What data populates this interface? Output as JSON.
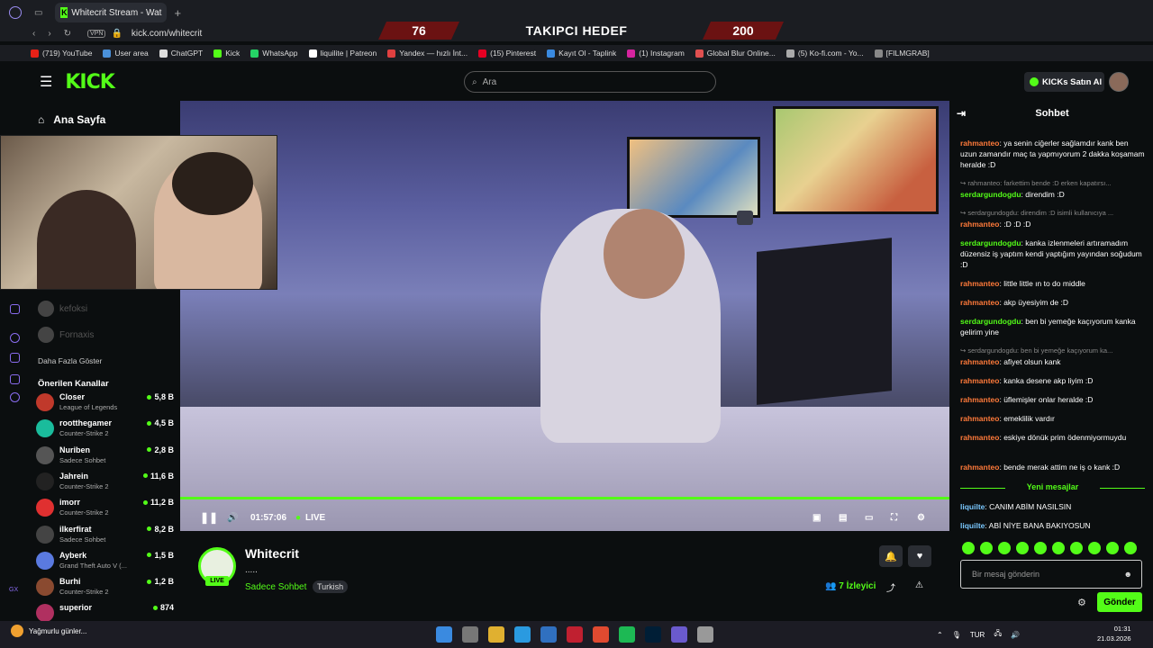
{
  "browser": {
    "tab_title": "Whitecrit Stream - Wat",
    "url": "kick.com/whitecrit",
    "vpn_label": "VPN",
    "bookmarks": [
      {
        "label": "(719) YouTube",
        "color": "#e62117"
      },
      {
        "label": "User area",
        "color": "#4a90d9"
      },
      {
        "label": "ChatGPT",
        "color": "#dddddd"
      },
      {
        "label": "Kick",
        "color": "#53fc18"
      },
      {
        "label": "WhatsApp",
        "color": "#25d366"
      },
      {
        "label": "liquilite | Patreon",
        "color": "#ffffff"
      },
      {
        "label": "Yandex — hızlı İnt...",
        "color": "#e04040"
      },
      {
        "label": "(15) Pinterest",
        "color": "#e60023"
      },
      {
        "label": "Kayıt Ol - Taplink",
        "color": "#3a8ae0"
      },
      {
        "label": "(1) Instagram",
        "color": "#d6249f"
      },
      {
        "label": "Global Blur Online...",
        "color": "#e05050"
      },
      {
        "label": "(5) Ko-fi.com - Yo...",
        "color": "#aaaaaa"
      },
      {
        "label": "[FILMGRAB]",
        "color": "#888888"
      }
    ]
  },
  "overlay": {
    "left": "76",
    "middle": "TAKIPCI HEDEF",
    "right": "200"
  },
  "header": {
    "logo": "KICK",
    "search_placeholder": "Ara",
    "buy_kicks": "KICKs Satın Al"
  },
  "sidebar": {
    "home": "Ana Sayfa",
    "ghost_channels": [
      "kefoksi",
      "Fornaxis"
    ],
    "show_more": "Daha Fazla Göster",
    "suggested_title": "Önerilen Kanallar",
    "channels": [
      {
        "name": "Closer",
        "game": "League of Legends",
        "viewers": "5,8 B",
        "color": "#c0392b"
      },
      {
        "name": "rootthegamer",
        "game": "Counter-Strike 2",
        "viewers": "4,5 B",
        "color": "#1abc9c"
      },
      {
        "name": "Nuriben",
        "game": "Sadece Sohbet",
        "viewers": "2,8 B",
        "color": "#555555"
      },
      {
        "name": "Jahrein",
        "game": "Counter-Strike 2",
        "viewers": "11,6 B",
        "color": "#222222"
      },
      {
        "name": "imorr",
        "game": "Counter-Strike 2",
        "viewers": "11,2 B",
        "color": "#e03030"
      },
      {
        "name": "ilkerfirat",
        "game": "Sadece Sohbet",
        "viewers": "8,2 B",
        "color": "#444444"
      },
      {
        "name": "Ayberk",
        "game": "Grand Theft Auto V (...",
        "viewers": "1,5 B",
        "color": "#5a7ae0"
      },
      {
        "name": "Burhi",
        "game": "Counter-Strike 2",
        "viewers": "1,2 B",
        "color": "#8a4a30"
      },
      {
        "name": "superior",
        "game": "",
        "viewers": "874",
        "color": "#b03060"
      }
    ]
  },
  "player": {
    "time": "01:57:06",
    "live": "LIVE"
  },
  "stream": {
    "name": "Whitecrit",
    "title": ".....",
    "category": "Sadece Sohbet",
    "language": "Turkish",
    "viewers": "7",
    "viewers_label": "İzleyici",
    "live_badge": "LIVE"
  },
  "chat": {
    "title": "Sohbet",
    "messages": [
      {
        "type": "msg",
        "user": "rahmanteo",
        "color": "orange",
        "text": "ya senin ciğerler sağlamdır kank ben uzun zamandır maç ta yapmıyorum 2 dakka koşamam heralde :D"
      },
      {
        "type": "reply",
        "text": "↪ rahmanteo: farkettim bende :D erken kapatırsı..."
      },
      {
        "type": "msg",
        "user": "serdargundogdu",
        "color": "green",
        "text": "direndim :D"
      },
      {
        "type": "reply",
        "text": "↪ serdargundogdu: direndim :D isimli kullanıcıya ..."
      },
      {
        "type": "msg",
        "user": "rahmanteo",
        "color": "orange",
        "text": ":D :D :D"
      },
      {
        "type": "msg",
        "user": "serdargundogdu",
        "color": "green",
        "text": "kanka izlenmeleri artıramadım düzensiz iş yaptım kendi yaptığım yayından soğudum :D"
      },
      {
        "type": "msg",
        "user": "rahmanteo",
        "color": "orange",
        "text": "little little ın to do middle"
      },
      {
        "type": "msg",
        "user": "rahmanteo",
        "color": "orange",
        "text": "akp üyesiyim de :D"
      },
      {
        "type": "msg",
        "user": "serdargundogdu",
        "color": "green",
        "text": "ben bi yemeğe kaçıyorum kanka gelirim yine"
      },
      {
        "type": "reply",
        "text": "↪ serdargundogdu: ben bi yemeğe kaçıyorum ka..."
      },
      {
        "type": "msg",
        "user": "rahmanteo",
        "color": "orange",
        "text": "afiyet olsun kank"
      },
      {
        "type": "msg",
        "user": "rahmanteo",
        "color": "orange",
        "text": "kanka desene akp liyim :D"
      },
      {
        "type": "msg",
        "user": "rahmanteo",
        "color": "orange",
        "text": "üflemişler onlar heralde :D"
      },
      {
        "type": "msg",
        "user": "rahmanteo",
        "color": "orange",
        "text": "emeklilik vardır"
      },
      {
        "type": "msg",
        "user": "rahmanteo",
        "color": "orange",
        "text": "eskiye dönük prim ödenmiyormuydu"
      },
      {
        "type": "msg",
        "user": "rahmanteo",
        "color": "orange",
        "text": "bende merak attim ne iş o kank :D"
      }
    ],
    "new_messages_label": "Yeni mesajlar",
    "new_messages": [
      {
        "user": "liquilte",
        "text": "CANIM ABİM NASILSIN"
      },
      {
        "user": "liquilte",
        "text": "ABİ NİYE BANA BAKIYOSUN"
      }
    ],
    "input_placeholder": "Bir mesaj gönderin",
    "send_label": "Gönder"
  },
  "taskbar": {
    "weather": "Yağmurlu günler...",
    "lang": "TUR",
    "time": "01:31",
    "date": "21.03.2026"
  }
}
